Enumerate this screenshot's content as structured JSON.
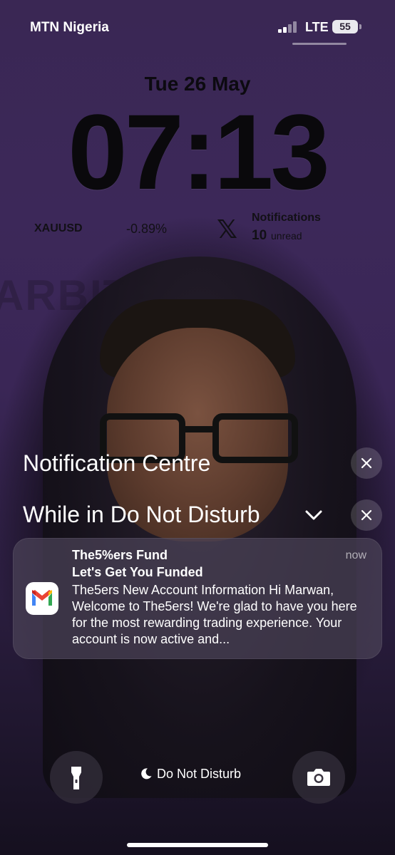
{
  "status_bar": {
    "carrier": "MTN Nigeria",
    "network": "LTE",
    "battery": "55"
  },
  "lock_screen": {
    "date": "Tue 26 May",
    "time": "07:13",
    "widgets": {
      "stock": {
        "symbol": "XAUUSD",
        "change": "-0.89%"
      },
      "x": {
        "icon": "x-logo-icon",
        "title": "Notifications",
        "count": "10",
        "unread_label": "unread"
      }
    },
    "background_text": "ARBITR"
  },
  "notification_center": {
    "title": "Notification Centre",
    "dnd_group_title": "While in Do Not Disturb",
    "notification": {
      "app_icon": "gmail-icon",
      "sender": "The5%ers Fund",
      "subject": "Let's Get You Funded",
      "body": "The5ers New Account Information Hi Marwan, Welcome to The5ers! We're glad to have you here for the most rewarding trading experience. Your account is now active and...",
      "time": "now"
    }
  },
  "bottom_bar": {
    "left_button_icon": "flashlight-icon",
    "focus_label": "Do Not Disturb",
    "right_button_icon": "camera-icon"
  },
  "colors": {
    "background": "#3a2754",
    "card": "#4b4258",
    "text": "#ffffff"
  }
}
